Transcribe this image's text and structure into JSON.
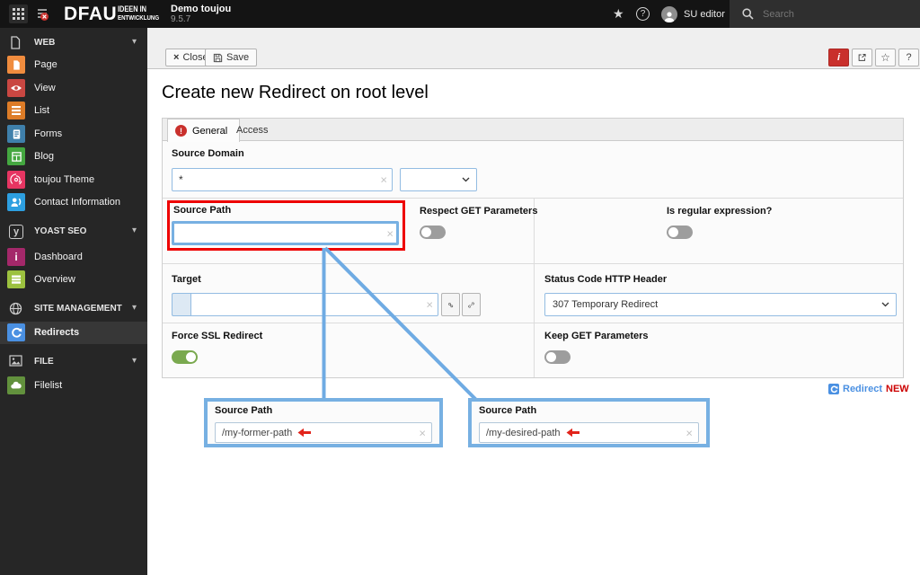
{
  "topbar": {
    "logo": "DFAU",
    "logo_claim_line1": "IDEEN IN",
    "logo_claim_line2": "ENTWICKLUNG",
    "site_name": "Demo toujou",
    "version": "9.5.7",
    "user_name": "SU editor",
    "search_placeholder": "Search",
    "icons": [
      "modules-grid-icon",
      "opened-documents-icon",
      "bookmark-star-icon",
      "help-icon",
      "avatar",
      "search-icon"
    ]
  },
  "sidebar": {
    "sections": [
      {
        "label": "WEB",
        "icon": "document-icon",
        "items": [
          {
            "label": "Page",
            "icon": "page-icon"
          },
          {
            "label": "View",
            "icon": "eye-icon"
          },
          {
            "label": "List",
            "icon": "list-icon"
          },
          {
            "label": "Forms",
            "icon": "form-icon"
          },
          {
            "label": "Blog",
            "icon": "blog-icon"
          },
          {
            "label": "toujou Theme",
            "icon": "fingerprint-icon"
          },
          {
            "label": "Contact Information",
            "icon": "contact-icon"
          }
        ]
      },
      {
        "label": "YOAST SEO",
        "icon": "yoast-icon",
        "items": [
          {
            "label": "Dashboard",
            "icon": "info-icon"
          },
          {
            "label": "Overview",
            "icon": "lines-icon"
          }
        ]
      },
      {
        "label": "SITE MANAGEMENT",
        "icon": "globe-icon",
        "items": [
          {
            "label": "Redirects",
            "icon": "redirect-icon",
            "active": true
          }
        ]
      },
      {
        "label": "FILE",
        "icon": "image-icon",
        "items": [
          {
            "label": "Filelist",
            "icon": "cloud-icon"
          }
        ]
      }
    ]
  },
  "docheader": {
    "close_label": "Close",
    "save_label": "Save",
    "info_label": "i",
    "help_label": "?"
  },
  "page": {
    "title": "Create new Redirect on root level"
  },
  "tabs": {
    "general": "General",
    "access": "Access"
  },
  "form": {
    "source_domain": {
      "label": "Source Domain",
      "value": "*"
    },
    "source_path": {
      "label": "Source Path",
      "value": ""
    },
    "respect_get_parameters": {
      "label": "Respect GET Parameters",
      "on": false
    },
    "is_regular_expression": {
      "label": "Is regular expression?",
      "on": false
    },
    "target": {
      "label": "Target",
      "value": ""
    },
    "status_code": {
      "label": "Status Code HTTP Header",
      "value": "307 Temporary Redirect"
    },
    "force_ssl_redirect": {
      "label": "Force SSL Redirect",
      "on": true
    },
    "keep_get_parameters": {
      "label": "Keep GET Parameters",
      "on": false
    }
  },
  "legend": {
    "redirect_label": "Redirect",
    "new_label": "NEW"
  },
  "callouts": [
    {
      "label": "Source Path",
      "value": "/my-former-path"
    },
    {
      "label": "Source Path",
      "value": "/my-desired-path"
    }
  ],
  "colors": {
    "highlight_red": "#ee0000",
    "highlight_blue": "#77b0e2",
    "toggle_on_green": "#7aa94f",
    "accent_blue": "#4a90e2",
    "new_red": "#cc0000"
  }
}
